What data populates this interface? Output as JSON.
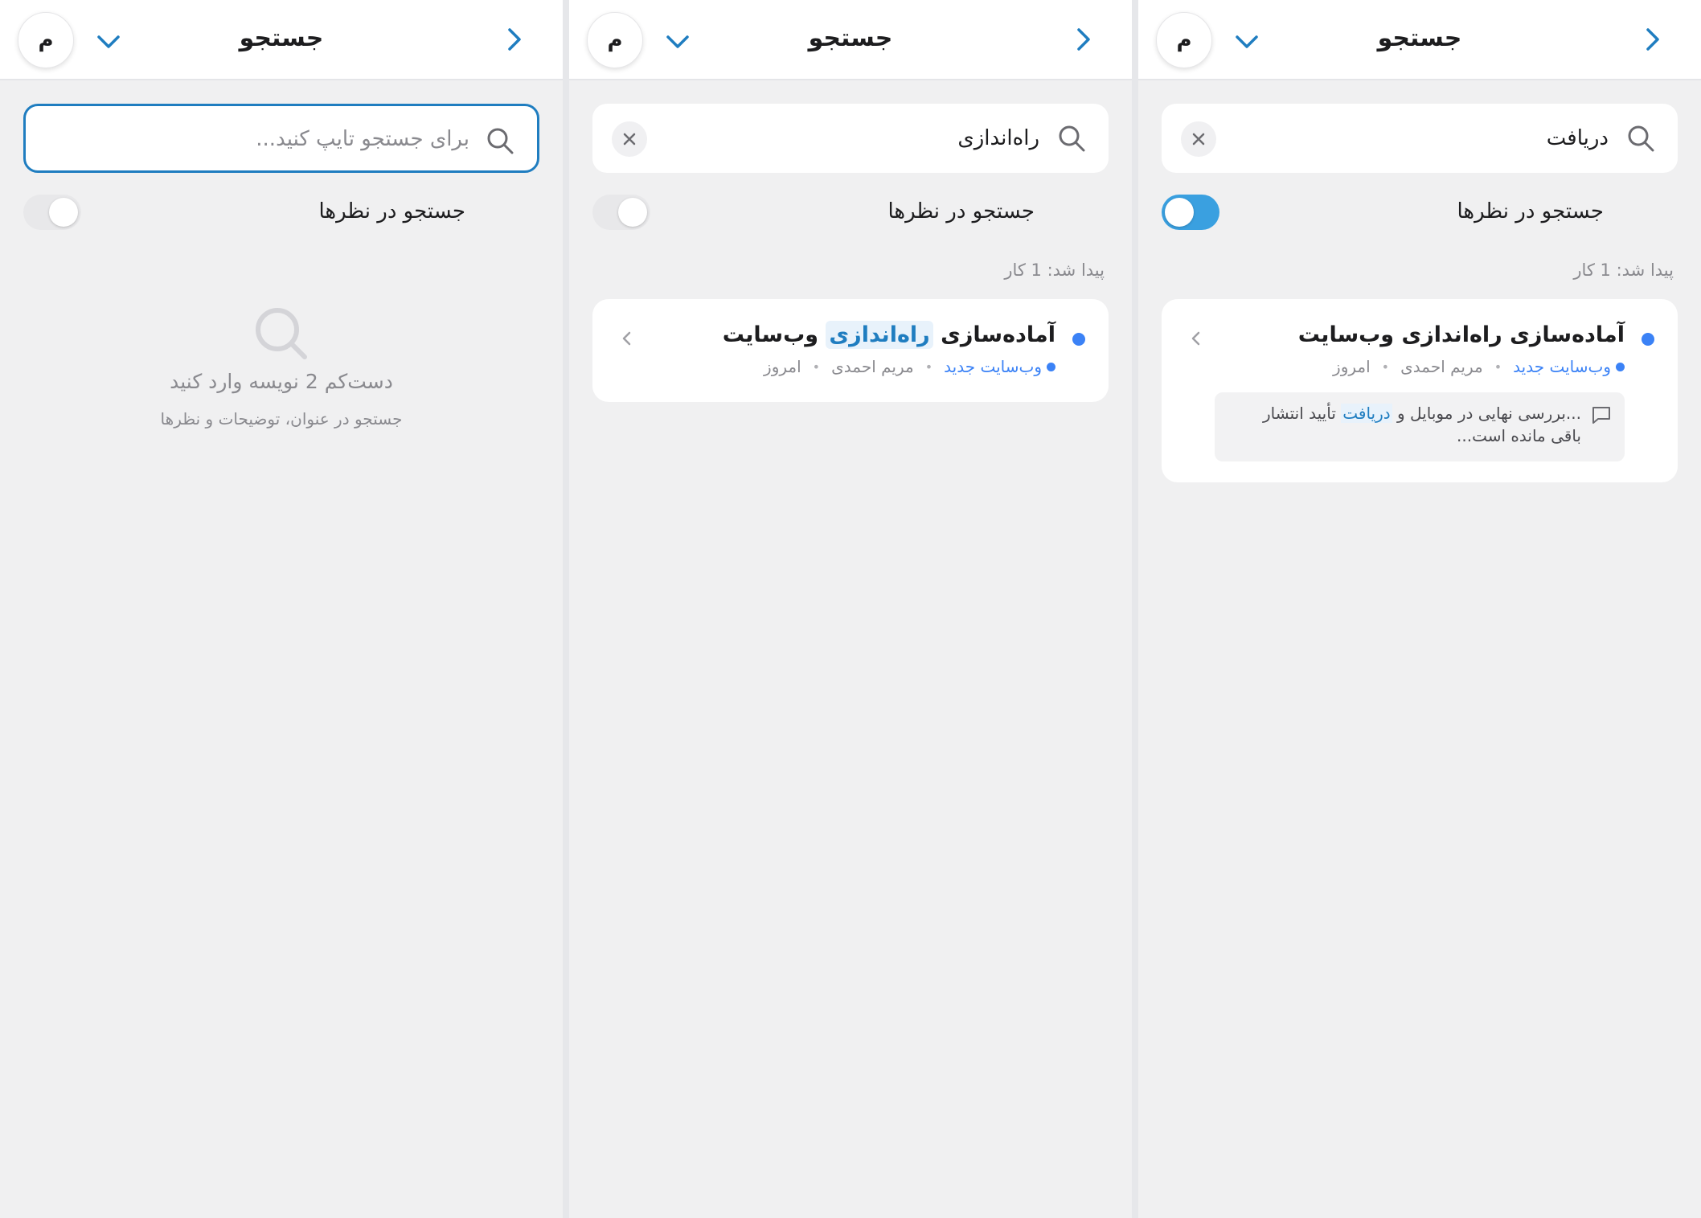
{
  "colors": {
    "accent": "#1f7dc0",
    "dot": "#3b82f6",
    "toggle_on": "#3aa0e0",
    "background": "#f0f0f1"
  },
  "screens": [
    {
      "header": {
        "title": "جستجو",
        "avatar": "م",
        "back_icon": "chevron-right-icon",
        "menu_icon": "chevron-down-icon"
      },
      "search": {
        "value": "",
        "placeholder": "برای جستجو تایپ کنید...",
        "focused": true
      },
      "comments_toggle": {
        "label": "جستجو در نظرها",
        "on": false
      },
      "empty_state": {
        "icon": "search-icon",
        "title": "دست‌کم 2 نویسه وارد کنید",
        "subtitle": "جستجو در عنوان، توضیحات و نظرها"
      }
    },
    {
      "header": {
        "title": "جستجو",
        "avatar": "م"
      },
      "search": {
        "value": "راه‌اندازی",
        "placeholder": "",
        "focused": false
      },
      "comments_toggle": {
        "label": "جستجو در نظرها",
        "on": false
      },
      "results_count": "پیدا شد: 1 کار",
      "result": {
        "title_before": "آماده‌سازی ",
        "title_highlight": "راه‌اندازی",
        "title_after": " وب‌سایت",
        "project": "وب‌سایت جدید",
        "assignee": "مریم احمدی",
        "date": "امروز"
      }
    },
    {
      "header": {
        "title": "جستجو",
        "avatar": "م"
      },
      "search": {
        "value": "دریافت",
        "placeholder": "",
        "focused": false
      },
      "comments_toggle": {
        "label": "جستجو در نظرها",
        "on": true
      },
      "results_count": "پیدا شد: 1 کار",
      "result": {
        "title": "آماده‌سازی راه‌اندازی وب‌سایت",
        "project": "وب‌سایت جدید",
        "assignee": "مریم احمدی",
        "date": "امروز",
        "comment_before": "...بررسی نهایی در موبایل و ",
        "comment_highlight": "دریافت",
        "comment_after": " تأیید انتشار باقی مانده است..."
      }
    }
  ]
}
